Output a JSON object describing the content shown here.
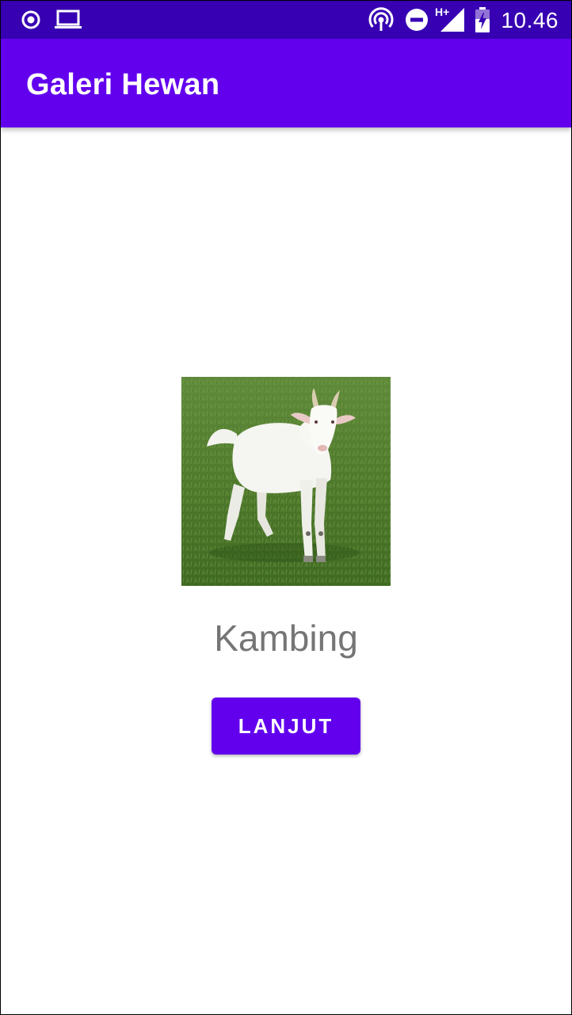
{
  "status_bar": {
    "time": "10.46",
    "network_type": "H+",
    "background_color": "#3700b3",
    "left_icons": [
      "record-icon",
      "laptop-icon"
    ],
    "right_icons": [
      "hotspot-icon",
      "do-not-disturb-icon",
      "signal-icon",
      "battery-icon"
    ]
  },
  "app_bar": {
    "title": "Galeri Hewan",
    "background_color": "#6200ee"
  },
  "main": {
    "animal_image": {
      "icon": "goat-photo"
    },
    "animal_name": "Kambing",
    "next_button_label": "LANJUT",
    "accent_color": "#6200ee"
  }
}
